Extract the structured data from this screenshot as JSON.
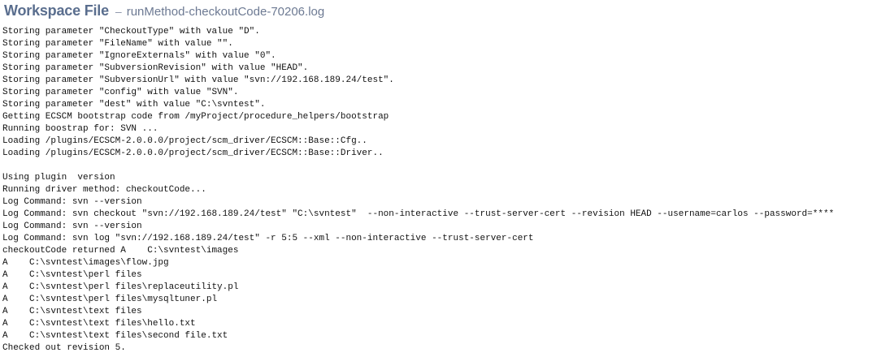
{
  "header": {
    "title": "Workspace File",
    "separator": "–",
    "filename": "runMethod-checkoutCode-70206.log"
  },
  "log": {
    "lines": [
      "Storing parameter \"CheckoutType\" with value \"D\".",
      "Storing parameter \"FileName\" with value \"\".",
      "Storing parameter \"IgnoreExternals\" with value \"0\".",
      "Storing parameter \"SubversionRevision\" with value \"HEAD\".",
      "Storing parameter \"SubversionUrl\" with value \"svn://192.168.189.24/test\".",
      "Storing parameter \"config\" with value \"SVN\".",
      "Storing parameter \"dest\" with value \"C:\\svntest\".",
      "Getting ECSCM bootstrap code from /myProject/procedure_helpers/bootstrap",
      "Running boostrap for: SVN ...",
      "Loading /plugins/ECSCM-2.0.0.0/project/scm_driver/ECSCM::Base::Cfg..",
      "Loading /plugins/ECSCM-2.0.0.0/project/scm_driver/ECSCM::Base::Driver..",
      "",
      "Using plugin  version",
      "Running driver method: checkoutCode...",
      "Log Command: svn --version",
      "Log Command: svn checkout \"svn://192.168.189.24/test\" \"C:\\svntest\"  --non-interactive --trust-server-cert --revision HEAD --username=carlos --password=****",
      "Log Command: svn --version",
      "Log Command: svn log \"svn://192.168.189.24/test\" -r 5:5 --xml --non-interactive --trust-server-cert",
      "checkoutCode returned A    C:\\svntest\\images",
      "A    C:\\svntest\\images\\flow.jpg",
      "A    C:\\svntest\\perl files",
      "A    C:\\svntest\\perl files\\replaceutility.pl",
      "A    C:\\svntest\\perl files\\mysqltuner.pl",
      "A    C:\\svntest\\text files",
      "A    C:\\svntest\\text files\\hello.txt",
      "A    C:\\svntest\\text files\\second file.txt",
      "Checked out revision 5."
    ]
  }
}
